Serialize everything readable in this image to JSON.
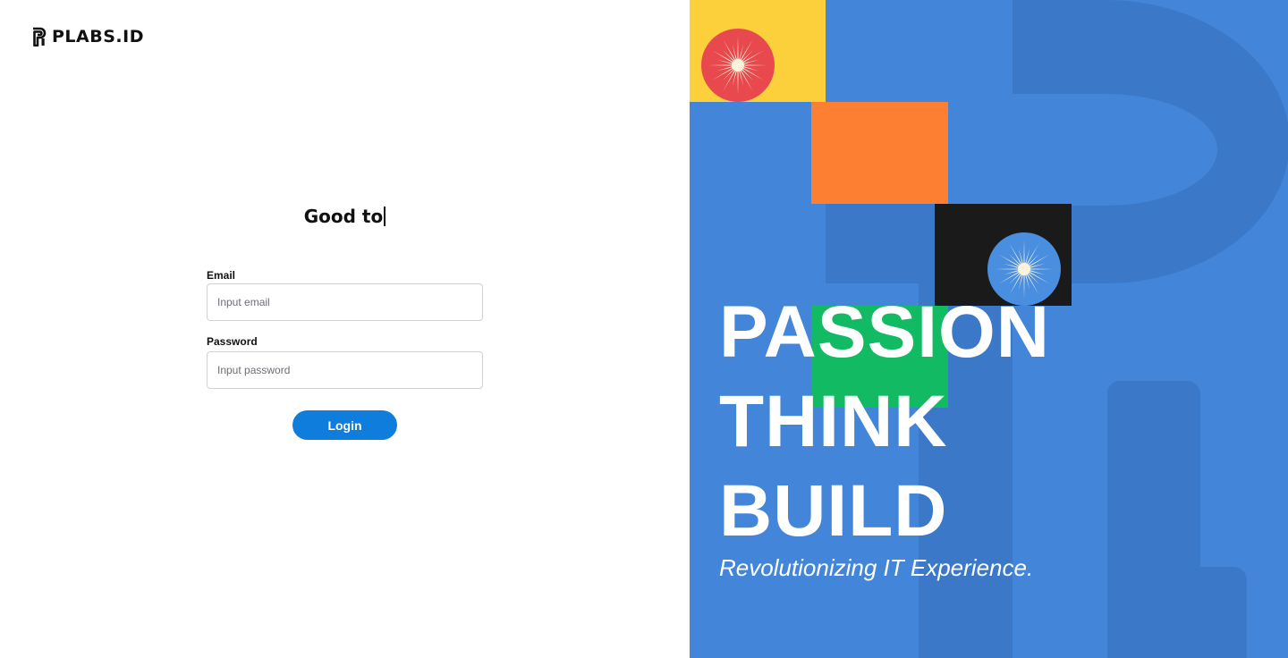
{
  "brand": {
    "name": "PLABS.ID",
    "logo_icon": "plabs-logo-icon"
  },
  "login": {
    "greeting": "Good to",
    "email": {
      "label": "Email",
      "placeholder": "Input email",
      "value": ""
    },
    "password": {
      "label": "Password",
      "placeholder": "Input password",
      "value": ""
    },
    "submit_label": "Login"
  },
  "hero": {
    "lines": [
      "PASSION",
      "THINK",
      "BUILD"
    ],
    "tagline": "Revolutionizing IT Experience.",
    "decorations": [
      "starburst-icon",
      "starburst-icon"
    ]
  },
  "colors": {
    "primary_button": "#0f7ddb",
    "hero_background": "#4285d9",
    "hero_mark": "#3c78c8",
    "yellow": "#fcd03a",
    "orange": "#fd7f32",
    "black": "#1a1a1a",
    "green": "#12ba63",
    "sun_red": "#e8494f",
    "sun_blue": "#4a8ee0",
    "sun_rays": "#fbf3dc"
  }
}
